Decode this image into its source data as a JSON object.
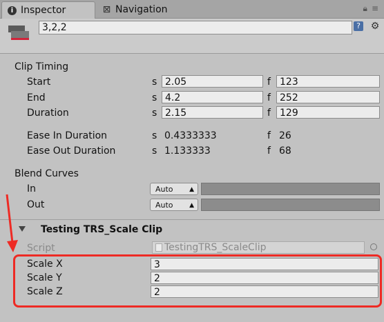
{
  "tabs": {
    "inspector": "Inspector",
    "navigation": "Navigation"
  },
  "header": {
    "name_value": "3,2,2",
    "help_icon": "?",
    "settings_icon": "sliders"
  },
  "clip_timing": {
    "title": "Clip Timing",
    "rows": [
      {
        "label": "Start",
        "s_unit": "s",
        "s_value": "2.05",
        "f_unit": "f",
        "f_value": "123"
      },
      {
        "label": "End",
        "s_unit": "s",
        "s_value": "4.2",
        "f_unit": "f",
        "f_value": "252"
      },
      {
        "label": "Duration",
        "s_unit": "s",
        "s_value": "2.15",
        "f_unit": "f",
        "f_value": "129"
      }
    ],
    "ease": [
      {
        "label": "Ease In Duration",
        "s_unit": "s",
        "s_value": "0.4333333",
        "f_unit": "f",
        "f_value": "26"
      },
      {
        "label": "Ease Out Duration",
        "s_unit": "s",
        "s_value": "1.133333",
        "f_unit": "f",
        "f_value": "68"
      }
    ]
  },
  "blend_curves": {
    "title": "Blend Curves",
    "rows": [
      {
        "label": "In",
        "dropdown": "Auto"
      },
      {
        "label": "Out",
        "dropdown": "Auto"
      }
    ]
  },
  "component": {
    "title": "Testing TRS_Scale Clip",
    "script_label": "Script",
    "script_value": "TestingTRS_ScaleClip",
    "fields": [
      {
        "label": "Scale X",
        "value": "3"
      },
      {
        "label": "Scale Y",
        "value": "2"
      },
      {
        "label": "Scale Z",
        "value": "2"
      }
    ]
  },
  "colors": {
    "highlight": "#ee2a24",
    "panel_bg": "#c2c2c2"
  }
}
